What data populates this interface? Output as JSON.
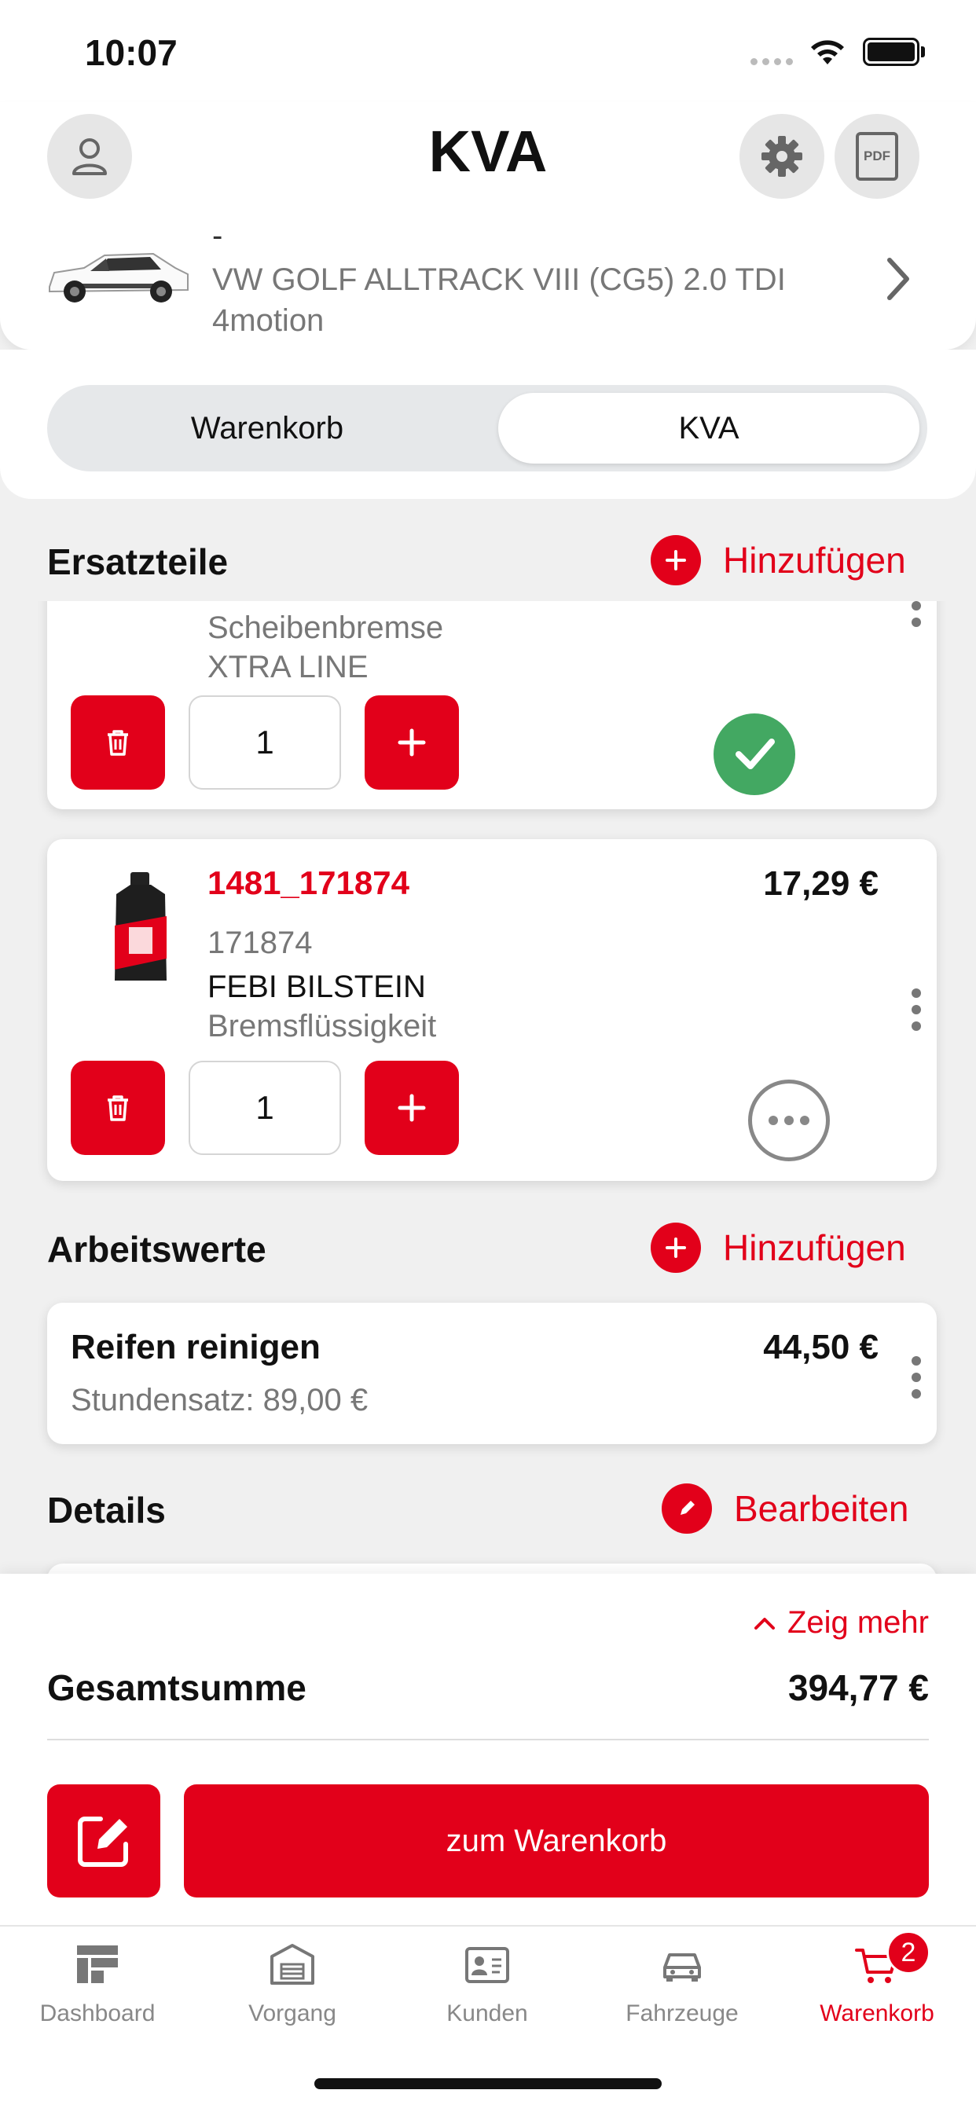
{
  "status_bar": {
    "time": "10:07"
  },
  "header": {
    "title": "KVA",
    "pdf_label": "PDF",
    "vehicle": {
      "dash": "-",
      "name": "VW GOLF ALLTRACK VIII (CG5) 2.0 TDI 4motion"
    }
  },
  "segments": {
    "left": "Warenkorb",
    "right": "KVA",
    "selected": "KVA"
  },
  "parts": {
    "title": "Ersatzteile",
    "add_label": "Hinzufügen",
    "items": [
      {
        "line1": "Scheibenbremse",
        "line2": "XTRA LINE",
        "qty": "1",
        "status": "confirmed"
      },
      {
        "id": "1481_171874",
        "number": "171874",
        "brand": "FEBI BILSTEIN",
        "desc": "Bremsflüssigkeit",
        "price": "17,29 €",
        "qty": "1",
        "status": "pending"
      }
    ]
  },
  "labor": {
    "title": "Arbeitswerte",
    "add_label": "Hinzufügen",
    "items": [
      {
        "name": "Reifen reinigen",
        "rate": "Stundensatz: 89,00 €",
        "price": "44,50 €"
      }
    ]
  },
  "details": {
    "title": "Details",
    "edit_label": "Bearbeiten"
  },
  "summary": {
    "show_more": "Zeig mehr",
    "total_label": "Gesamtsumme",
    "total_value": "394,77 €",
    "cart_button": "zum Warenkorb"
  },
  "tabs": [
    {
      "label": "Dashboard",
      "icon": "dashboard-icon"
    },
    {
      "label": "Vorgang",
      "icon": "garage-icon"
    },
    {
      "label": "Kunden",
      "icon": "contact-card-icon"
    },
    {
      "label": "Fahrzeuge",
      "icon": "car-icon"
    },
    {
      "label": "Warenkorb",
      "icon": "cart-icon",
      "badge": "2",
      "active": true
    }
  ],
  "colors": {
    "accent": "#e2001a",
    "success": "#43a862",
    "background": "#f0f0f0"
  }
}
